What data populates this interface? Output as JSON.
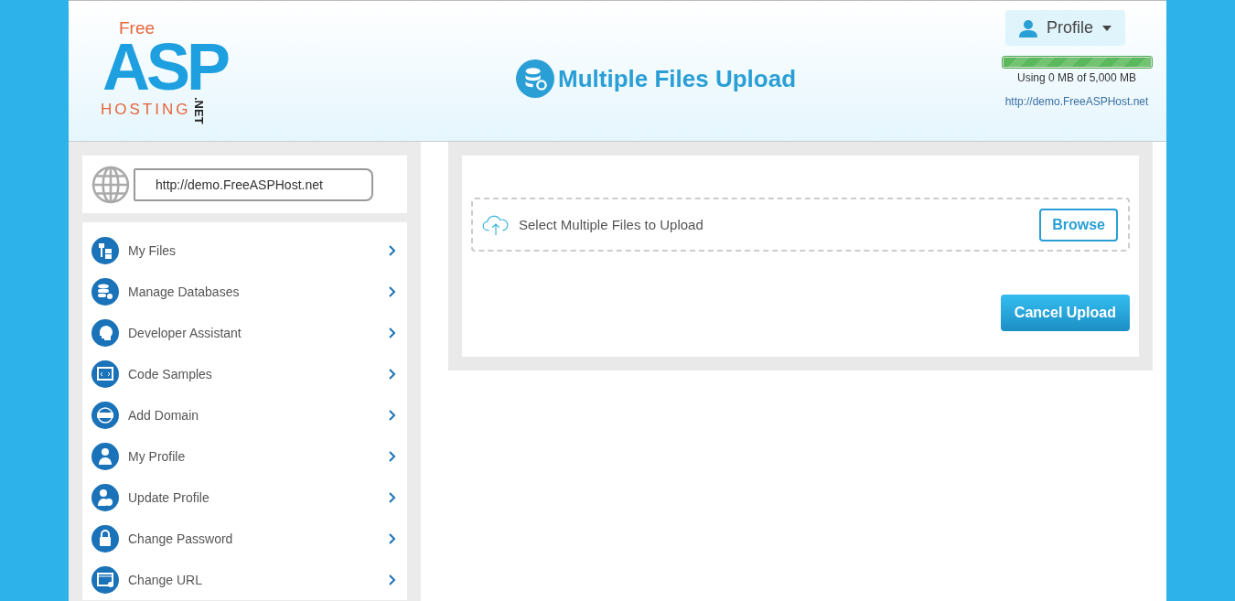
{
  "logo": {
    "free": "Free",
    "main": "ASP",
    "hosting": "HOSTING",
    "tld": ".NET"
  },
  "title": "Multiple Files Upload",
  "profile": {
    "label": "Profile"
  },
  "usage": {
    "level": 1,
    "text": "Using 0 MB of 5,000 MB"
  },
  "site_link": "http://demo.FreeASPHost.net",
  "sidebar": {
    "url": "http://demo.FreeASPHost.net",
    "items": [
      {
        "label": "My Files"
      },
      {
        "label": "Manage Databases"
      },
      {
        "label": "Developer Assistant"
      },
      {
        "label": "Code Samples"
      },
      {
        "label": "Add Domain"
      },
      {
        "label": "My Profile"
      },
      {
        "label": "Update Profile"
      },
      {
        "label": "Change Password"
      },
      {
        "label": "Change URL"
      }
    ]
  },
  "upload": {
    "prompt": "Select Multiple Files to Upload",
    "browse": "Browse",
    "cancel": "Cancel Upload"
  }
}
